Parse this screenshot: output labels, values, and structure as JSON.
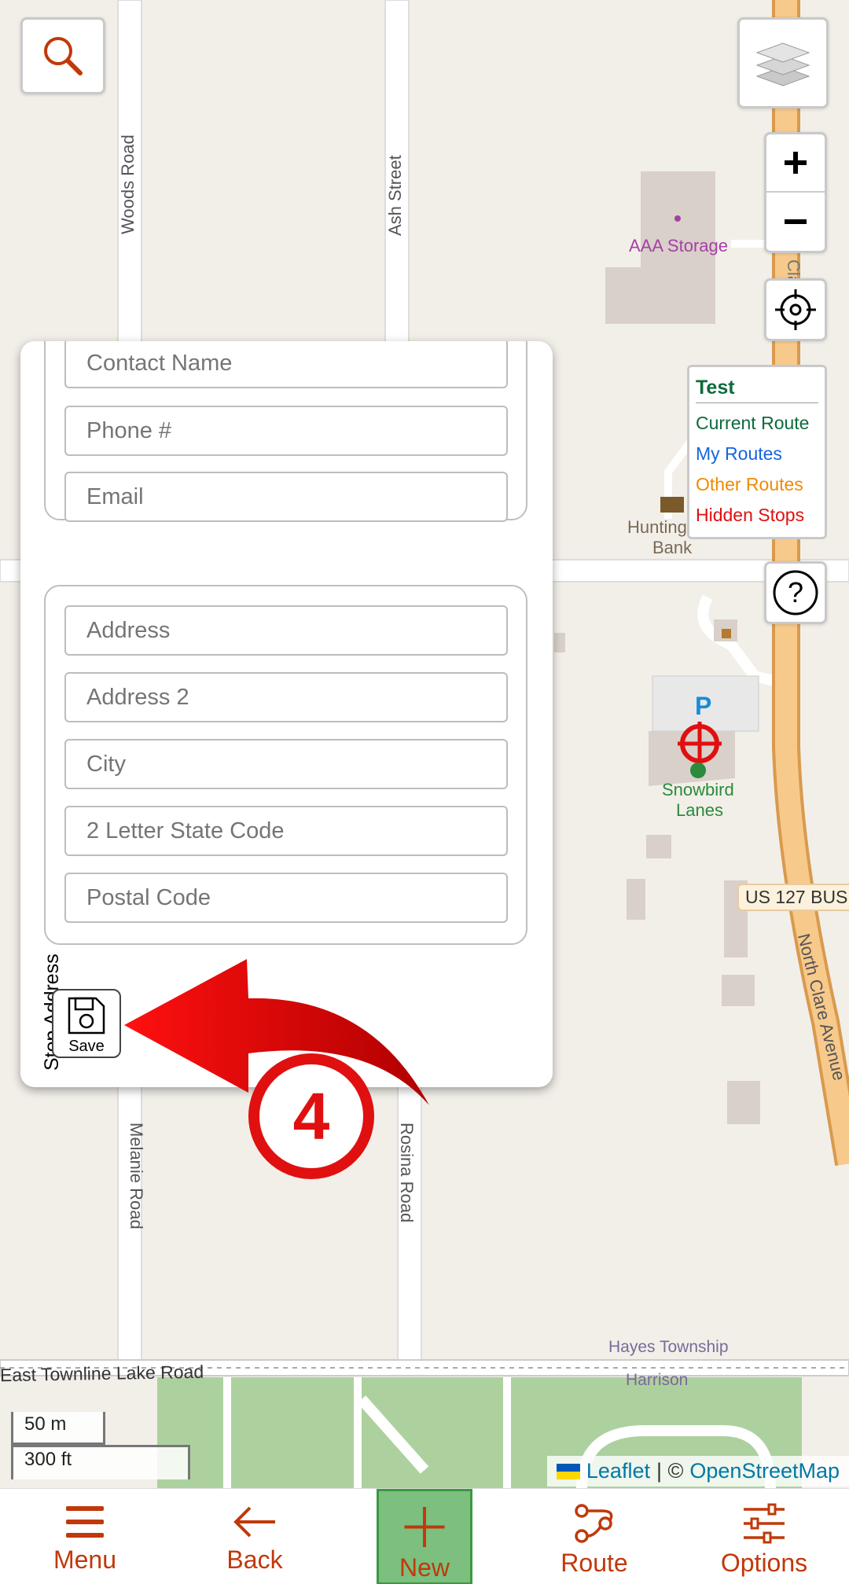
{
  "map": {
    "streets": {
      "woods_road": "Woods Road",
      "ash_street": "Ash Street",
      "melanie_road": "Melanie Road",
      "rosina_road": "Rosina Road",
      "north_clare_avenue": "North Clare Avenue",
      "clare_fragment": "Clare",
      "east_townline": "East Townline Lake Road",
      "us127": "US 127 BUS"
    },
    "pois": {
      "aaa_storage": "AAA Storage",
      "huntington_bank_1": "Hunting",
      "huntington_bank_2": "Bank",
      "snowbird_1": "Snowbird",
      "snowbird_2": "Lanes",
      "parking": "P",
      "hayes_township": "Hayes Township",
      "harrison": "Harrison"
    },
    "scale": {
      "metric": "50 m",
      "imperial": "300 ft"
    },
    "attribution": {
      "leaflet": "Leaflet",
      "separator": "| ©",
      "osm": "OpenStreetMap"
    }
  },
  "legend": {
    "title": "Test",
    "items": [
      {
        "label": "Current Route",
        "color": "#0d6b3d"
      },
      {
        "label": "My Routes",
        "color": "#1565e0"
      },
      {
        "label": "Other Routes",
        "color": "#f08a00"
      },
      {
        "label": "Hidden Stops",
        "color": "#e01010"
      }
    ]
  },
  "form": {
    "contact": {
      "contact_name_placeholder": "Contact Name",
      "phone_placeholder": "Phone #",
      "email_placeholder": "Email"
    },
    "stop_address": {
      "legend": "Stop Address",
      "address_placeholder": "Address",
      "address2_placeholder": "Address 2",
      "city_placeholder": "City",
      "state_placeholder": "2 Letter State Code",
      "postal_placeholder": "Postal Code"
    },
    "save_label": "Save"
  },
  "annotation": {
    "step": "4",
    "color": "#e01010"
  },
  "bottom_nav": {
    "menu": "Menu",
    "back": "Back",
    "new": "New",
    "route": "Route",
    "options": "Options"
  },
  "colors": {
    "accent": "#c0390b",
    "active_nav": "#7cbf7f",
    "road_major": "#f7c98b"
  }
}
